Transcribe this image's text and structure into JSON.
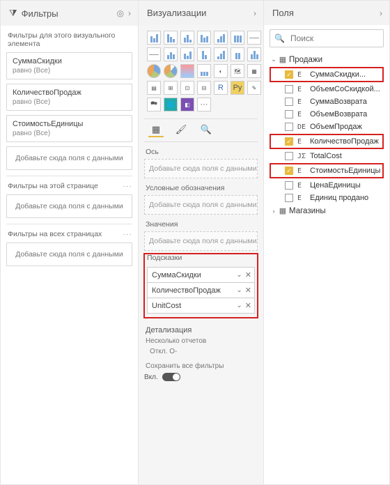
{
  "filters": {
    "title": "Фильтры",
    "sections": {
      "visual": {
        "label": "Фильтры для этого визуального элемента",
        "cards": [
          {
            "name": "СуммаСкидки",
            "state": "равно (Все)"
          },
          {
            "name": "КоличествоПродаж",
            "state": "равно (Все)"
          },
          {
            "name": "СтоимостьЕдиницы",
            "state": "равно (Все)"
          }
        ],
        "drop": "Добавьте сюда поля с данными"
      },
      "page": {
        "label": "Фильтры на этой странице",
        "drop": "Добавьте сюда поля с данными"
      },
      "all": {
        "label": "Фильтры на всех страницах",
        "drop": "Добавьте сюда поля с данными"
      }
    }
  },
  "viz": {
    "title": "Визуализации",
    "wells": {
      "axis": {
        "label": "Ось",
        "drop": "Добавьте сюда поля с данными"
      },
      "legend": {
        "label": "Условные обозначения",
        "drop": "Добавьте сюда поля с данными"
      },
      "values": {
        "label": "Значения",
        "drop": "Добавьте сюда поля с данными"
      },
      "tooltips": {
        "label": "Подсказки",
        "items": [
          "СуммаСкидки",
          "КоличествоПродаж",
          "UnitCost"
        ]
      }
    },
    "drill": {
      "label": "Детализация",
      "cross": "Несколько отчетов",
      "toggle_text": "Откл. O-",
      "keep_label": "Сохранить все фильтры",
      "keep_on": "Вкл."
    }
  },
  "fields": {
    "title": "Поля",
    "search_placeholder": "Поиск",
    "tables": [
      {
        "name": "Продажи",
        "expanded": true,
        "rows": [
          {
            "checked": true,
            "type": "Е",
            "name": "СуммаСкидки...",
            "hl": true
          },
          {
            "checked": false,
            "type": "Е",
            "name": "ОбъемСоСкидкой...",
            "hl": false
          },
          {
            "checked": false,
            "type": "Е",
            "name": "СуммаВозврата",
            "hl": false
          },
          {
            "checked": false,
            "type": "Е",
            "name": "ОбъемВозврата",
            "hl": false
          },
          {
            "checked": false,
            "type": "DЕ",
            "name": "ОбъемПродаж",
            "hl": false
          },
          {
            "checked": true,
            "type": "Е",
            "name": "КоличествоПродаж",
            "hl": true
          },
          {
            "checked": false,
            "type": "JΣ",
            "name": "TotalCost",
            "hl": false
          },
          {
            "checked": true,
            "type": "Е",
            "name": "СтоимостьЕдиницы",
            "hl": true
          },
          {
            "checked": false,
            "type": "Е",
            "name": "ЦенаЕдиницы",
            "hl": false
          },
          {
            "checked": false,
            "type": "Е",
            "name": "Единиц продано",
            "hl": false
          }
        ]
      },
      {
        "name": "Магазины",
        "expanded": false,
        "rows": []
      }
    ]
  }
}
